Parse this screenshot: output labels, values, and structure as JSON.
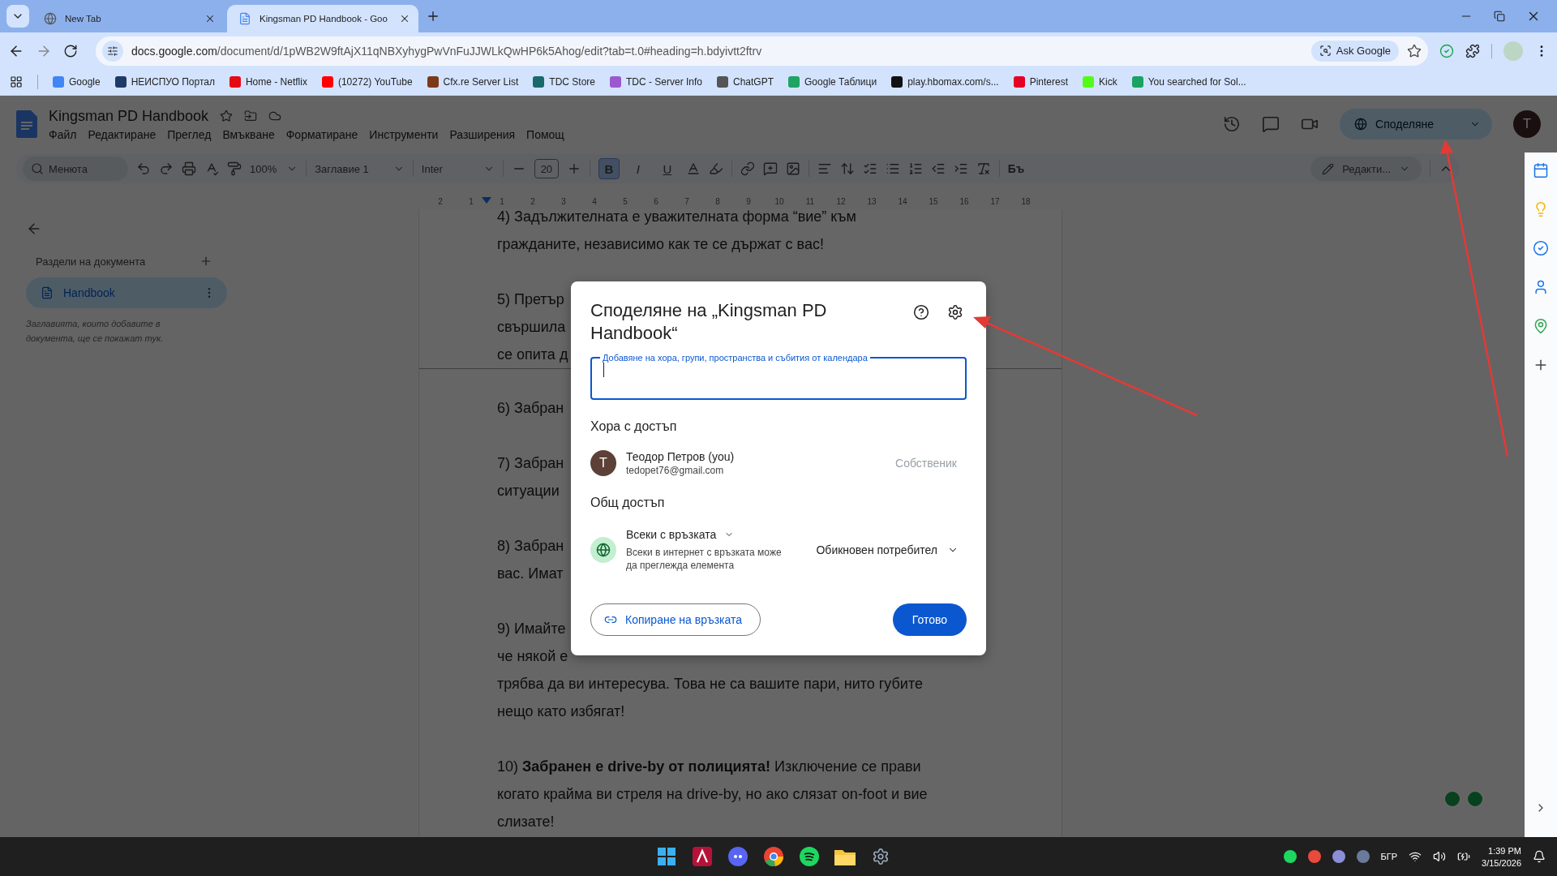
{
  "browser": {
    "tabs": [
      {
        "title": "New Tab",
        "selected": false
      },
      {
        "title": "Kingsman PD Handbook - Goo",
        "selected": true
      }
    ],
    "address": {
      "host": "docs.google.com",
      "path": "/document/d/1pWB2W9ftAjX11qNBXyhygPwVnFuJJWLkQwHP6k5Ahog/edit?tab=t.0#heading=h.bdyivtt2ftrv"
    },
    "ask_google": "Ask Google",
    "bookmarks": [
      {
        "label": "Google",
        "color": "#4285f4"
      },
      {
        "label": "НЕИСПУО Портал",
        "color": "#1f3a66"
      },
      {
        "label": "Home - Netflix",
        "color": "#e50914"
      },
      {
        "label": "(10272) YouTube",
        "color": "#ff0000"
      },
      {
        "label": "Cfx.re Server List",
        "color": "#7a3a1a"
      },
      {
        "label": "TDC Store",
        "color": "#1a6a6a"
      },
      {
        "label": "TDC - Server Info",
        "color": "#9b59d0"
      },
      {
        "label": "ChatGPT",
        "color": "#555555"
      },
      {
        "label": "Google Таблици",
        "color": "#1fa463"
      },
      {
        "label": "play.hbomax.com/s...",
        "color": "#111111"
      },
      {
        "label": "Pinterest",
        "color": "#e60023"
      },
      {
        "label": "Kick",
        "color": "#53fc18"
      },
      {
        "label": "You searched for Sol...",
        "color": "#1aa260"
      }
    ]
  },
  "docs": {
    "title": "Kingsman PD Handbook",
    "menu": [
      "Файл",
      "Редактиране",
      "Преглед",
      "Вмъкване",
      "Форматиране",
      "Инструменти",
      "Разширения",
      "Помощ"
    ],
    "share": "Споделяне",
    "avatar": "T",
    "toolbar": {
      "search": "Менюта",
      "zoom": "100%",
      "style": "Заглавие 1",
      "font": "Inter",
      "size": "20",
      "format": [
        {
          "label": "B",
          "selected": true
        },
        {
          "label": "I",
          "selected": false
        },
        {
          "label": "U",
          "selected": false
        }
      ],
      "styles_glyph": "Бъ",
      "mode": "Редакти..."
    },
    "ruler": [
      "2",
      "1",
      "1",
      "2",
      "3",
      "4",
      "5",
      "6",
      "7",
      "8",
      "9",
      "10",
      "11",
      "12",
      "13",
      "14",
      "15",
      "16",
      "17",
      "18"
    ],
    "sidebar": {
      "heading": "Раздели на документа",
      "tabs": [
        {
          "label": "Handbook",
          "selected": true
        }
      ],
      "hint": "Заглавията, които добавите в документа, ще се покажат тук."
    },
    "page": [
      {
        "kind": "line",
        "text": "4) Задължителната е уважителната форма “вие” към"
      },
      {
        "kind": "line",
        "text": "гражданите, независимо как те се държат с вас!"
      },
      {
        "kind": "gap"
      },
      {
        "kind": "line",
        "text": "5) Претър"
      },
      {
        "kind": "line",
        "text": "свършила"
      },
      {
        "kind": "line",
        "text": "се опита д"
      },
      {
        "kind": "page_break"
      },
      {
        "kind": "line",
        "text": "6) Забран"
      },
      {
        "kind": "gap"
      },
      {
        "kind": "line",
        "text": "7) Забран"
      },
      {
        "kind": "line",
        "text": "ситуации"
      },
      {
        "kind": "gap"
      },
      {
        "kind": "line",
        "text": "8) Забран"
      },
      {
        "kind": "line",
        "text": "вас. Имат"
      },
      {
        "kind": "gap"
      },
      {
        "kind": "line",
        "text": "9) Имайте"
      },
      {
        "kind": "line",
        "text": "че някой е"
      },
      {
        "kind": "line",
        "text": "трябва да ви интересува. Това не са вашите пари, нито губите"
      },
      {
        "kind": "line",
        "text": "нещо като избягат!"
      },
      {
        "kind": "gap"
      },
      {
        "kind": "line",
        "text": "10) **Забранен е drive-by от полицията!** Изключение се прави"
      },
      {
        "kind": "line",
        "text": "когато крайма ви стреля на drive-by, но ако слязат on-foot и вие"
      },
      {
        "kind": "line",
        "text": "слизате!"
      }
    ]
  },
  "dialog": {
    "title": "Споделяне на „Kingsman PD Handbook“",
    "field_label": "Добавяне на хора, групи, пространства и събития от календара",
    "people_heading": "Хора с достъп",
    "people": [
      {
        "initial": "T",
        "name": "Теодор Петров (you)",
        "email": "tedopet76@gmail.com",
        "role": "Собственик"
      }
    ],
    "general_heading": "Общ достъп",
    "access": "Всеки с връзката",
    "access_note": "Всеки в интернет с връзката може да преглежда елемента",
    "access_role": "Обикновен потребител",
    "copy_link": "Копиране на връзката",
    "done": "Готово"
  },
  "taskbar": {
    "language": "БГР",
    "time": "1:39 PM",
    "date": "3/15/2026"
  }
}
